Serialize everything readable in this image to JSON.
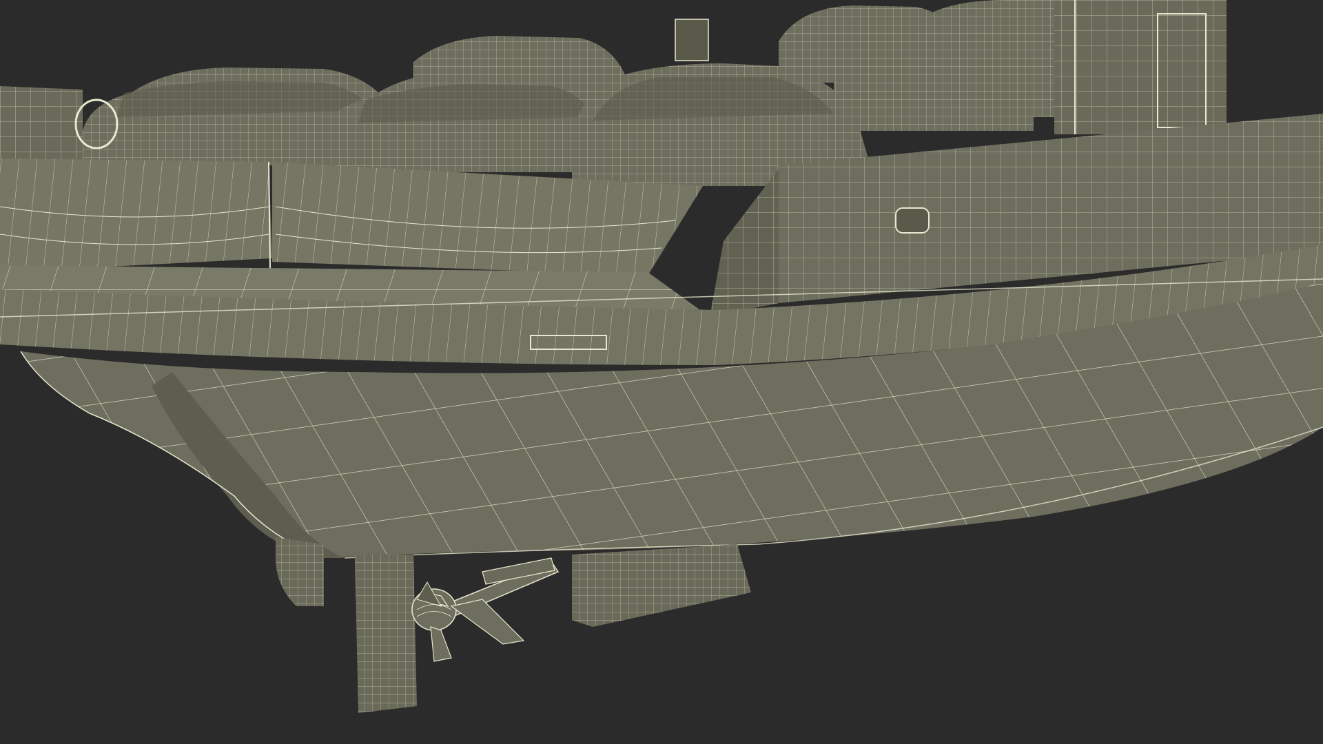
{
  "viewport": {
    "background": "#2b2b2b"
  },
  "model": {
    "subject": "car-ferry-wireframe-stern-view",
    "colors": {
      "hull": "#727262",
      "hull_dark": "#5c5c4e",
      "hull_shadow": "#4d4d40",
      "deck": "#7a7a69",
      "wire": "#e8e8d0",
      "car": "#6e6e5e",
      "car_dark": "#58584a"
    }
  }
}
